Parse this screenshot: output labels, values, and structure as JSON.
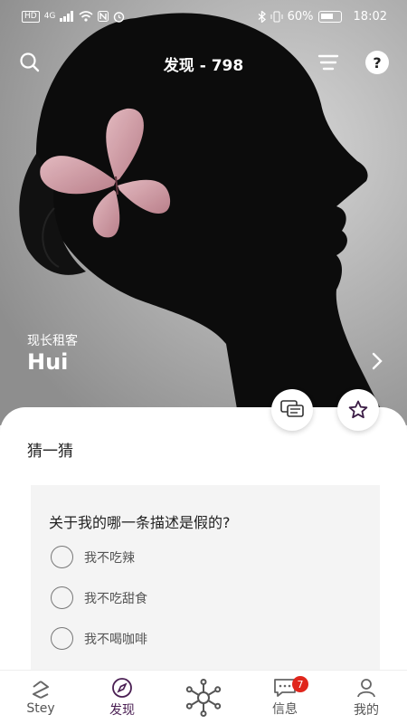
{
  "status_bar": {
    "left_tags": [
      "HD",
      "4G"
    ],
    "battery": "60%",
    "time": "18:02"
  },
  "header": {
    "title": "发现 - 798",
    "icons": [
      "search-icon",
      "filter-icon",
      "help-icon"
    ],
    "help_glyph": "?"
  },
  "profile": {
    "subtitle": "现长租客",
    "name": "Hui"
  },
  "card": {
    "section_title": "猜一猜",
    "question": "关于我的哪一条描述是假的?",
    "options": [
      "我不吃辣",
      "我不吃甜食",
      "我不喝咖啡"
    ]
  },
  "tabbar": {
    "tabs": [
      {
        "label": "Stey",
        "icon": "stey-logo-icon"
      },
      {
        "label": "发现",
        "icon": "compass-icon",
        "active": true
      },
      {
        "label": "",
        "icon": "network-hub-icon"
      },
      {
        "label": "信息",
        "icon": "message-icon",
        "badge": "7"
      },
      {
        "label": "我的",
        "icon": "person-icon"
      }
    ]
  },
  "colors": {
    "accent": "#4a1f53",
    "badge": "#e0261c",
    "quiz_bg": "#f4f4f4"
  }
}
